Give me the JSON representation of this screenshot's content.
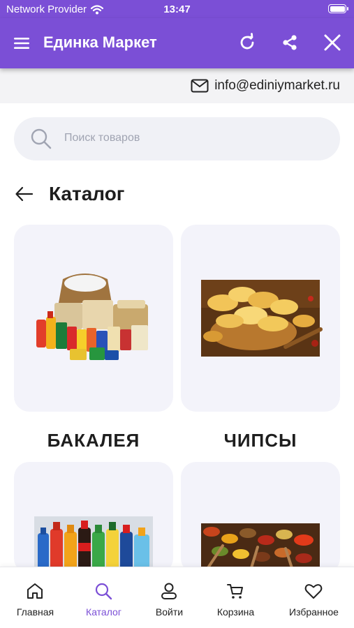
{
  "status_bar": {
    "carrier": "Network Provider",
    "time": "13:47",
    "battery": 1.0
  },
  "app_bar": {
    "title": "Единка Маркет"
  },
  "contact": {
    "email": "info@ediniymarket.ru"
  },
  "search": {
    "placeholder": "Поиск товаров"
  },
  "page": {
    "title": "Каталог"
  },
  "catalog": [
    {
      "label": "БАКАЛЕЯ",
      "image": "groceries-photo"
    },
    {
      "label": "ЧИПСЫ",
      "image": "chips-photo"
    },
    {
      "label": "",
      "image": "soft-drinks-photo"
    },
    {
      "label": "",
      "image": "spices-photo"
    }
  ],
  "tabs": [
    {
      "label": "Главная",
      "icon": "home-icon",
      "active": false
    },
    {
      "label": "Каталог",
      "icon": "search-icon",
      "active": true
    },
    {
      "label": "Войти",
      "icon": "user-icon",
      "active": false
    },
    {
      "label": "Корзина",
      "icon": "cart-icon",
      "active": false
    },
    {
      "label": "Избранное",
      "icon": "heart-icon",
      "active": false
    }
  ],
  "colors": {
    "accent": "#7b4fd6",
    "card_bg": "#f3f3fa",
    "search_bg": "#f0f1f6"
  }
}
